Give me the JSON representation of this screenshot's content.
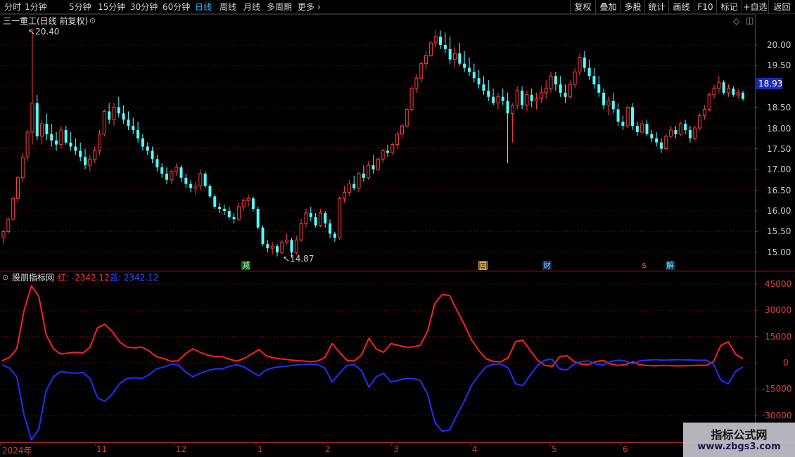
{
  "toolbar": {
    "timeframes": [
      "分时",
      "1分钟",
      "5分钟",
      "15分钟",
      "30分钟",
      "60分钟",
      "日线",
      "周线",
      "月线",
      "多周期",
      "更多"
    ],
    "active": "日线",
    "buttons": [
      "复权",
      "叠加",
      "多股",
      "统计",
      "画线",
      "F10",
      "标记",
      "+自选",
      "返回"
    ]
  },
  "main_chart": {
    "title": "三一重工(日线 前复权)",
    "last_price": "18.93",
    "high_marker": "20.40",
    "low_marker": "14.87",
    "price_axis": [
      "20.00",
      "19.50",
      "19.00",
      "18.50",
      "18.00",
      "17.50",
      "17.00",
      "16.50",
      "16.00",
      "15.50",
      "15.00"
    ],
    "events": [
      {
        "text": "减",
        "color": "#3a9a3a"
      },
      {
        "text": "回",
        "color": "#c89a3a"
      },
      {
        "text": "财",
        "color": "#3a8ad0"
      },
      {
        "text": "$",
        "color": "#e03030"
      },
      {
        "text": "解",
        "color": "#3a8ad0"
      }
    ]
  },
  "indicator": {
    "name": "股朋指标网",
    "red_label": "红: -2342.12",
    "blue_label": "蓝: 2342.12",
    "axis": [
      "45000",
      "30000",
      "15000",
      "0",
      "-15000",
      "-30000"
    ]
  },
  "date_axis": [
    "2024年",
    "11",
    "12",
    "1",
    "2",
    "3",
    "4",
    "5",
    "6"
  ],
  "watermark": {
    "line1": "指标公式网",
    "line2": "www.zbgs3.com"
  },
  "colors": {
    "up": "#ff3c3c",
    "down": "#54ffff",
    "red_line": "#ff2020",
    "blue_line": "#2030ff",
    "grid": "#7a1010"
  },
  "chart_data": [
    {
      "type": "candlestick",
      "title": "三一重工(日线 前复权)",
      "ylim": [
        14.7,
        20.6
      ],
      "x_labels": [
        "2024年",
        "11",
        "12",
        "1",
        "2",
        "3",
        "4",
        "5",
        "6"
      ],
      "candles": [
        [
          15.35,
          15.55,
          15.2,
          15.5
        ],
        [
          15.5,
          15.85,
          15.45,
          15.8
        ],
        [
          15.8,
          16.35,
          15.75,
          16.3
        ],
        [
          16.3,
          16.85,
          16.2,
          16.8
        ],
        [
          16.8,
          17.4,
          16.7,
          17.3
        ],
        [
          17.3,
          17.95,
          17.2,
          17.9
        ],
        [
          17.9,
          20.4,
          17.6,
          18.6
        ],
        [
          18.6,
          18.8,
          17.7,
          17.8
        ],
        [
          17.8,
          18.2,
          17.6,
          18.1
        ],
        [
          18.1,
          18.35,
          17.7,
          17.85
        ],
        [
          17.85,
          18.1,
          17.55,
          17.7
        ],
        [
          17.7,
          17.9,
          17.45,
          17.6
        ],
        [
          17.6,
          18.05,
          17.5,
          17.95
        ],
        [
          17.95,
          18.05,
          17.6,
          17.65
        ],
        [
          17.65,
          17.9,
          17.45,
          17.55
        ],
        [
          17.55,
          17.75,
          17.35,
          17.45
        ],
        [
          17.45,
          17.65,
          17.2,
          17.3
        ],
        [
          17.3,
          17.5,
          17.0,
          17.1
        ],
        [
          17.1,
          17.35,
          16.95,
          17.25
        ],
        [
          17.25,
          17.55,
          17.15,
          17.45
        ],
        [
          17.45,
          17.95,
          17.35,
          17.85
        ],
        [
          17.85,
          18.45,
          17.8,
          18.4
        ],
        [
          18.4,
          18.6,
          18.1,
          18.2
        ],
        [
          18.2,
          18.6,
          18.05,
          18.5
        ],
        [
          18.5,
          18.75,
          18.25,
          18.35
        ],
        [
          18.35,
          18.55,
          18.1,
          18.2
        ],
        [
          18.2,
          18.4,
          17.95,
          18.05
        ],
        [
          18.05,
          18.25,
          17.85,
          17.95
        ],
        [
          17.95,
          18.15,
          17.65,
          17.75
        ],
        [
          17.75,
          17.85,
          17.45,
          17.55
        ],
        [
          17.55,
          17.65,
          17.35,
          17.45
        ],
        [
          17.45,
          17.55,
          17.15,
          17.25
        ],
        [
          17.25,
          17.35,
          16.95,
          17.05
        ],
        [
          17.05,
          17.15,
          16.8,
          16.9
        ],
        [
          16.9,
          17.05,
          16.65,
          16.75
        ],
        [
          16.75,
          17.0,
          16.65,
          16.95
        ],
        [
          16.95,
          17.15,
          16.85,
          17.05
        ],
        [
          17.05,
          17.1,
          16.7,
          16.8
        ],
        [
          16.8,
          16.9,
          16.55,
          16.65
        ],
        [
          16.65,
          16.75,
          16.45,
          16.55
        ],
        [
          16.55,
          16.7,
          16.4,
          16.6
        ],
        [
          16.6,
          17.0,
          16.5,
          16.9
        ],
        [
          16.9,
          16.95,
          16.55,
          16.6
        ],
        [
          16.6,
          16.65,
          16.3,
          16.35
        ],
        [
          16.35,
          16.4,
          16.05,
          16.1
        ],
        [
          16.1,
          16.2,
          15.95,
          16.05
        ],
        [
          16.05,
          16.15,
          15.9,
          16.0
        ],
        [
          16.0,
          16.1,
          15.8,
          15.85
        ],
        [
          15.85,
          15.95,
          15.7,
          15.8
        ],
        [
          15.8,
          16.2,
          15.75,
          16.1
        ],
        [
          16.1,
          16.3,
          16.0,
          16.25
        ],
        [
          16.25,
          16.4,
          16.1,
          16.3
        ],
        [
          16.3,
          16.35,
          16.0,
          16.05
        ],
        [
          16.05,
          16.1,
          15.55,
          15.6
        ],
        [
          15.6,
          15.65,
          15.15,
          15.2
        ],
        [
          15.2,
          15.3,
          15.0,
          15.1
        ],
        [
          15.1,
          15.25,
          14.95,
          15.15
        ],
        [
          15.15,
          15.2,
          14.9,
          15.0
        ],
        [
          15.0,
          15.3,
          14.95,
          15.25
        ],
        [
          15.25,
          15.45,
          15.2,
          15.3
        ],
        [
          15.3,
          15.35,
          14.87,
          15.0
        ],
        [
          15.0,
          15.4,
          14.95,
          15.3
        ],
        [
          15.3,
          15.8,
          15.25,
          15.7
        ],
        [
          15.7,
          16.05,
          15.6,
          15.95
        ],
        [
          15.95,
          16.1,
          15.75,
          15.85
        ],
        [
          15.85,
          15.95,
          15.6,
          15.65
        ],
        [
          15.65,
          16.05,
          15.6,
          15.95
        ],
        [
          15.95,
          16.0,
          15.6,
          15.7
        ],
        [
          15.7,
          15.8,
          15.35,
          15.45
        ],
        [
          15.45,
          15.5,
          15.25,
          15.35
        ],
        [
          15.35,
          16.35,
          15.3,
          16.3
        ],
        [
          16.3,
          16.6,
          16.2,
          16.45
        ],
        [
          16.45,
          16.75,
          16.35,
          16.65
        ],
        [
          16.65,
          16.85,
          16.5,
          16.55
        ],
        [
          16.55,
          16.95,
          16.45,
          16.9
        ],
        [
          16.9,
          17.1,
          16.7,
          16.8
        ],
        [
          16.8,
          17.2,
          16.75,
          17.1
        ],
        [
          17.1,
          17.35,
          16.9,
          17.0
        ],
        [
          17.0,
          17.3,
          16.95,
          17.25
        ],
        [
          17.25,
          17.5,
          17.15,
          17.45
        ],
        [
          17.45,
          17.6,
          17.3,
          17.4
        ],
        [
          17.4,
          17.65,
          17.35,
          17.6
        ],
        [
          17.6,
          17.9,
          17.5,
          17.85
        ],
        [
          17.85,
          18.1,
          17.75,
          18.05
        ],
        [
          18.05,
          18.5,
          18.0,
          18.45
        ],
        [
          18.45,
          19.0,
          18.4,
          18.95
        ],
        [
          18.95,
          19.3,
          18.85,
          19.2
        ],
        [
          19.2,
          19.6,
          19.1,
          19.55
        ],
        [
          19.55,
          19.85,
          19.4,
          19.75
        ],
        [
          19.75,
          20.1,
          19.7,
          20.05
        ],
        [
          20.05,
          20.35,
          19.95,
          20.2
        ],
        [
          20.2,
          20.35,
          19.9,
          20.0
        ],
        [
          20.0,
          20.3,
          19.8,
          19.9
        ],
        [
          19.9,
          20.2,
          19.55,
          19.65
        ],
        [
          19.65,
          19.95,
          19.45,
          19.8
        ],
        [
          19.8,
          20.05,
          19.5,
          19.55
        ],
        [
          19.55,
          19.85,
          19.35,
          19.45
        ],
        [
          19.45,
          19.7,
          19.25,
          19.35
        ],
        [
          19.35,
          19.55,
          19.1,
          19.2
        ],
        [
          19.2,
          19.4,
          18.95,
          19.05
        ],
        [
          19.05,
          19.25,
          18.8,
          18.9
        ],
        [
          18.9,
          19.15,
          18.65,
          18.75
        ],
        [
          18.75,
          18.95,
          18.55,
          18.6
        ],
        [
          18.6,
          18.85,
          18.45,
          18.75
        ],
        [
          18.75,
          18.95,
          18.55,
          18.65
        ],
        [
          18.65,
          18.85,
          17.15,
          18.35
        ],
        [
          18.35,
          18.6,
          17.65,
          18.55
        ],
        [
          18.55,
          19.0,
          18.45,
          18.9
        ],
        [
          18.9,
          19.0,
          18.45,
          18.55
        ],
        [
          18.55,
          18.9,
          18.4,
          18.8
        ],
        [
          18.8,
          18.95,
          18.5,
          18.65
        ],
        [
          18.65,
          18.85,
          18.45,
          18.7
        ],
        [
          18.7,
          19.0,
          18.6,
          18.85
        ],
        [
          18.85,
          19.15,
          18.7,
          18.95
        ],
        [
          18.95,
          19.35,
          18.85,
          19.25
        ],
        [
          19.25,
          19.35,
          18.9,
          19.05
        ],
        [
          19.05,
          19.25,
          18.75,
          18.85
        ],
        [
          18.85,
          19.05,
          18.6,
          18.75
        ],
        [
          18.75,
          19.15,
          18.7,
          19.05
        ],
        [
          19.05,
          19.45,
          18.95,
          19.35
        ],
        [
          19.35,
          19.8,
          19.25,
          19.7
        ],
        [
          19.7,
          19.85,
          19.35,
          19.45
        ],
        [
          19.45,
          19.65,
          19.15,
          19.25
        ],
        [
          19.25,
          19.45,
          18.95,
          19.05
        ],
        [
          19.05,
          19.25,
          18.75,
          18.85
        ],
        [
          18.85,
          18.95,
          18.45,
          18.55
        ],
        [
          18.55,
          18.75,
          18.3,
          18.65
        ],
        [
          18.65,
          18.85,
          18.35,
          18.45
        ],
        [
          18.45,
          18.6,
          18.05,
          18.15
        ],
        [
          18.15,
          18.3,
          17.95,
          18.05
        ],
        [
          18.05,
          18.55,
          18.0,
          18.5
        ],
        [
          18.5,
          18.6,
          17.95,
          18.05
        ],
        [
          18.05,
          18.15,
          17.8,
          17.9
        ],
        [
          17.9,
          18.2,
          17.85,
          18.1
        ],
        [
          18.1,
          18.2,
          17.8,
          17.85
        ],
        [
          17.85,
          17.95,
          17.65,
          17.75
        ],
        [
          17.75,
          17.9,
          17.55,
          17.65
        ],
        [
          17.65,
          17.75,
          17.4,
          17.5
        ],
        [
          17.5,
          17.85,
          17.45,
          17.8
        ],
        [
          17.8,
          18.05,
          17.75,
          17.95
        ],
        [
          17.95,
          18.05,
          17.75,
          17.85
        ],
        [
          17.85,
          18.15,
          17.8,
          18.1
        ],
        [
          18.1,
          18.2,
          17.85,
          17.95
        ],
        [
          17.95,
          18.05,
          17.65,
          17.75
        ],
        [
          17.75,
          18.05,
          17.7,
          18.0
        ],
        [
          18.0,
          18.35,
          17.95,
          18.3
        ],
        [
          18.3,
          18.55,
          18.2,
          18.45
        ],
        [
          18.45,
          18.85,
          18.4,
          18.8
        ],
        [
          18.8,
          19.05,
          18.7,
          18.95
        ],
        [
          18.95,
          19.25,
          18.85,
          19.1
        ],
        [
          19.1,
          19.15,
          18.8,
          18.85
        ],
        [
          18.85,
          19.05,
          18.75,
          18.95
        ],
        [
          18.95,
          19.0,
          18.75,
          18.8
        ],
        [
          18.8,
          18.95,
          18.7,
          18.85
        ],
        [
          18.85,
          18.9,
          18.65,
          18.7
        ]
      ]
    },
    {
      "type": "line",
      "title": "股朋指标网",
      "ylim": [
        -38000,
        48000
      ],
      "series": [
        {
          "name": "红",
          "values": [
            1200,
            3000,
            8000,
            30000,
            44000,
            38000,
            16000,
            8000,
            5000,
            5500,
            6000,
            5500,
            9000,
            20000,
            22000,
            18000,
            12000,
            9000,
            8500,
            9000,
            7000,
            3500,
            2500,
            900,
            1100,
            5200,
            8000,
            6000,
            4500,
            3500,
            3500,
            2000,
            1000,
            2400,
            5000,
            7500,
            4000,
            2800,
            2200,
            1800,
            1300,
            1000,
            700,
            1000,
            3000,
            11000,
            6000,
            1500,
            1000,
            4500,
            14000,
            8000,
            6000,
            11000,
            10000,
            9000,
            9000,
            10000,
            18000,
            34000,
            39000,
            38500,
            30000,
            22000,
            13000,
            7000,
            2200,
            800,
            600,
            3000,
            12000,
            13000,
            7000,
            1500,
            -1500,
            -2000,
            3500,
            4000,
            700,
            -800,
            -1000,
            800,
            1300,
            -800,
            -1500,
            -1000,
            600,
            -1200,
            -1500,
            -1800,
            -1500,
            -1600,
            -1800,
            -1700,
            -1600,
            -1400,
            -1500,
            800,
            10000,
            12000,
            5000,
            2342
          ]
        },
        {
          "name": "蓝",
          "values": [
            -1200,
            -3000,
            -8000,
            -30000,
            -44000,
            -38000,
            -16000,
            -8000,
            -5000,
            -5500,
            -6000,
            -5500,
            -9000,
            -20000,
            -22000,
            -18000,
            -12000,
            -9000,
            -8500,
            -9000,
            -7000,
            -3500,
            -2500,
            -900,
            -1100,
            -5200,
            -8000,
            -6000,
            -4500,
            -3500,
            -3500,
            -2000,
            -1000,
            -2400,
            -5000,
            -7500,
            -4000,
            -2800,
            -2200,
            -1800,
            -1300,
            -1000,
            -700,
            -1000,
            -3000,
            -11000,
            -6000,
            -1500,
            -1000,
            -4500,
            -14000,
            -8000,
            -6000,
            -11000,
            -10000,
            -9000,
            -9000,
            -10000,
            -18000,
            -34000,
            -39000,
            -38500,
            -30000,
            -22000,
            -13000,
            -7000,
            -2200,
            -800,
            -600,
            -3000,
            -12000,
            -13000,
            -7000,
            -1500,
            1500,
            2000,
            -3500,
            -4000,
            -700,
            800,
            1000,
            -800,
            -1300,
            800,
            1500,
            1000,
            -600,
            1200,
            1500,
            1800,
            1500,
            1600,
            1800,
            1700,
            1600,
            1400,
            1500,
            -800,
            -10000,
            -12000,
            -5000,
            -2342
          ]
        }
      ]
    }
  ]
}
